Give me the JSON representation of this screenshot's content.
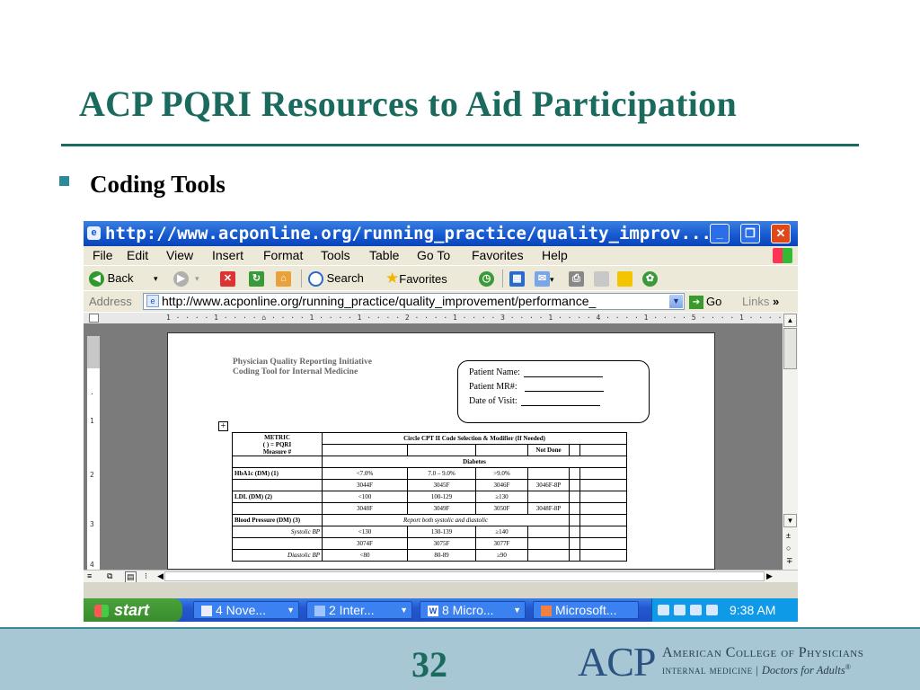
{
  "slide": {
    "title": "ACP PQRI Resources to Aid Participation",
    "bullet": "Coding Tools",
    "page_number": "32",
    "footer_logo": "ACP",
    "footer_name": "American College of Physicians",
    "footer_sub_a": "internal medicine",
    "footer_sub_sep": "|",
    "footer_sub_b": "Doctors for Adults",
    "footer_reg": "®"
  },
  "colors": {
    "title": "#1a6b5e",
    "footer_bg": "#a7c7d4",
    "xp_blue": "#1457cf",
    "start_green": "#3a8c2d"
  },
  "browser": {
    "title": "http://www.acponline.org/running_practice/quality_improv...",
    "window_buttons": {
      "minimize": "_",
      "restore": "❐",
      "close": "✕"
    },
    "menu": [
      "File",
      "Edit",
      "View",
      "Insert",
      "Format",
      "Tools",
      "Table",
      "Go To",
      "Favorites",
      "Help"
    ],
    "toolbar": {
      "back": "Back",
      "back_dd": "▾",
      "fwd_dd": "▾",
      "search": "Search",
      "favorites": "Favorites"
    },
    "address_label": "Address",
    "address_value": "http://www.acponline.org/running_practice/quality_improvement/performance_",
    "go": "Go",
    "links": "Links",
    "links_more": "»",
    "ruler": "1 · · · · 1 · · · · ⌂ · · · · 1 · · · · 1 · · · · 2 · · · · 1 · · · · 3 · · · · 1 · · · · 4 · · · · 1 · · · · 5 · · · · 1 · · · · 6 · · · ⌂ · · · 7 · · · ·"
  },
  "doc": {
    "header_line1": "Physician Quality Reporting Initiative",
    "header_line2": "Coding Tool for Internal Medicine",
    "patient_name": "Patient Name:",
    "patient_mr": "Patient MR#:",
    "date_of_visit": "Date of Visit:",
    "table": {
      "metric_h1": "METRIC",
      "metric_h2": "( ) = PQRI",
      "metric_h3": "Measure #",
      "circle_header": "Circle CPT II Code Selection & Modifier (If Needed)",
      "not_done": "Not Done",
      "section_diabetes": "Diabetes",
      "hba1c": {
        "label": "HbA1c (DM) (1)",
        "v1": "<7.0%",
        "v2": "7.0 – 9.0%",
        "v3": ">9.0%",
        "c1": "3044F",
        "c2": "3045F",
        "c3": "3046F",
        "nd": "3046F-8P"
      },
      "ldl": {
        "label": "LDL (DM) (2)",
        "v1": "<100",
        "v2": "100-129",
        "v3": "≥130",
        "c1": "3048F",
        "c2": "3049F",
        "c3": "3050F",
        "nd": "3048F-8P"
      },
      "bp": {
        "label": "Blood Pressure (DM) (3)",
        "note": "Report both systolic and diastolic",
        "sys_label": "Systolic BP",
        "v1": "<130",
        "v2": "130-139",
        "v3": "≥140",
        "c1": "3074F",
        "c2": "3075F",
        "c3": "3077F",
        "dia_label": "Diastolic BP",
        "d1": "<80",
        "d2": "80-89",
        "d3": "≥90"
      }
    }
  },
  "taskbar": {
    "start": "start",
    "tasks": [
      "4 Nove...",
      "2 Inter...",
      "8 Micro...",
      "Microsoft..."
    ],
    "time": "9:38 AM"
  }
}
